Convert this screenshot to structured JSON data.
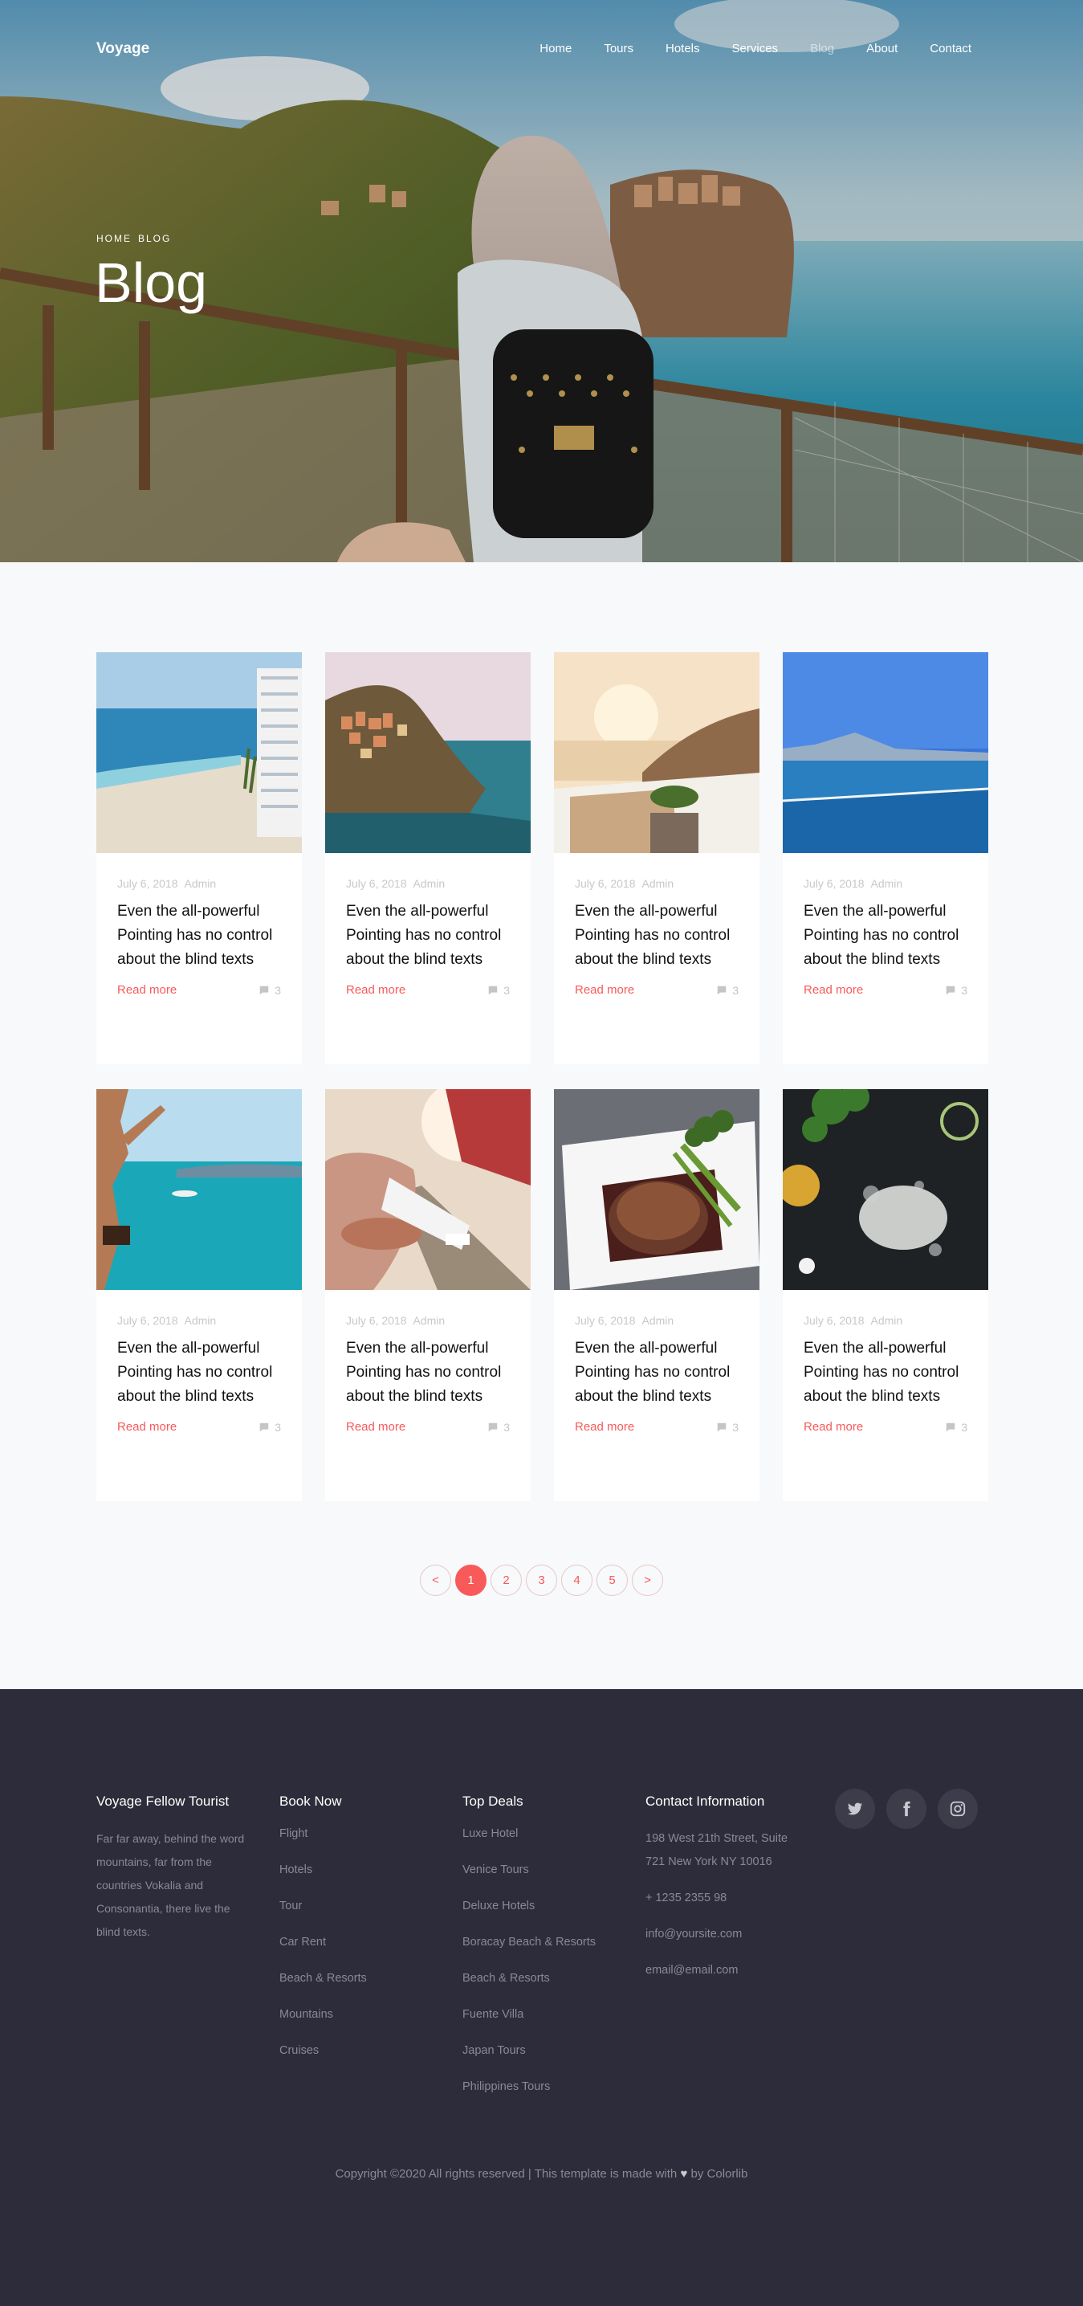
{
  "nav": {
    "brand": "Voyage",
    "items": [
      {
        "label": "Home",
        "active": false
      },
      {
        "label": "Tours",
        "active": false
      },
      {
        "label": "Hotels",
        "active": false
      },
      {
        "label": "Services",
        "active": false
      },
      {
        "label": "Blog",
        "active": true
      },
      {
        "label": "About",
        "active": false
      },
      {
        "label": "Contact",
        "active": false
      }
    ]
  },
  "hero": {
    "breadcrumb": [
      "HOME",
      "BLOG"
    ],
    "title": "Blog"
  },
  "posts": [
    {
      "date": "July 6, 2018",
      "author": "Admin",
      "title": "Even the all-powerful Pointing has no control about the blind texts",
      "read_more": "Read more",
      "comments": "3",
      "image": "beach-hotel"
    },
    {
      "date": "July 6, 2018",
      "author": "Admin",
      "title": "Even the all-powerful Pointing has no control about the blind texts",
      "read_more": "Read more",
      "comments": "3",
      "image": "cliff-village"
    },
    {
      "date": "July 6, 2018",
      "author": "Admin",
      "title": "Even the all-powerful Pointing has no control about the blind texts",
      "read_more": "Read more",
      "comments": "3",
      "image": "sunset-terrace"
    },
    {
      "date": "July 6, 2018",
      "author": "Admin",
      "title": "Even the all-powerful Pointing has no control about the blind texts",
      "read_more": "Read more",
      "comments": "3",
      "image": "infinity-pool"
    },
    {
      "date": "July 6, 2018",
      "author": "Admin",
      "title": "Even the all-powerful Pointing has no control about the blind texts",
      "read_more": "Read more",
      "comments": "3",
      "image": "sea-swimmer"
    },
    {
      "date": "July 6, 2018",
      "author": "Admin",
      "title": "Even the all-powerful Pointing has no control about the blind texts",
      "read_more": "Read more",
      "comments": "3",
      "image": "railway-couple"
    },
    {
      "date": "July 6, 2018",
      "author": "Admin",
      "title": "Even the all-powerful Pointing has no control about the blind texts",
      "read_more": "Read more",
      "comments": "3",
      "image": "steak-plate"
    },
    {
      "date": "July 6, 2018",
      "author": "Admin",
      "title": "Even the all-powerful Pointing has no control about the blind texts",
      "read_more": "Read more",
      "comments": "3",
      "image": "flour-table"
    }
  ],
  "pagination": {
    "prev": "<",
    "pages": [
      "1",
      "2",
      "3",
      "4",
      "5"
    ],
    "current": "1",
    "next": ">"
  },
  "footer": {
    "about": {
      "title": "Voyage Fellow Tourist",
      "text": "Far far away, behind the word mountains, far from the countries Vokalia and Consonantia, there live the blind texts."
    },
    "book_now": {
      "title": "Book Now",
      "links": [
        "Flight",
        "Hotels",
        "Tour",
        "Car Rent",
        "Beach & Resorts",
        "Mountains",
        "Cruises"
      ]
    },
    "top_deals": {
      "title": "Top Deals",
      "links": [
        "Luxe Hotel",
        "Venice Tours",
        "Deluxe Hotels",
        "Boracay Beach & Resorts",
        "Beach & Resorts",
        "Fuente Villa",
        "Japan Tours",
        "Philippines Tours"
      ]
    },
    "contact": {
      "title": "Contact Information",
      "address": "198 West 21th Street, Suite 721 New York NY 10016",
      "phone": "+ 1235 2355 98",
      "email1": "info@yoursite.com",
      "email2": "email@email.com"
    },
    "socials": [
      "twitter-icon",
      "facebook-icon",
      "instagram-icon"
    ],
    "copyright_before": "Copyright ©2020 All rights reserved | This template is made with",
    "copyright_after": "by Colorlib"
  },
  "colors": {
    "accent": "#f85959",
    "footer_bg": "#2c2c3a"
  }
}
